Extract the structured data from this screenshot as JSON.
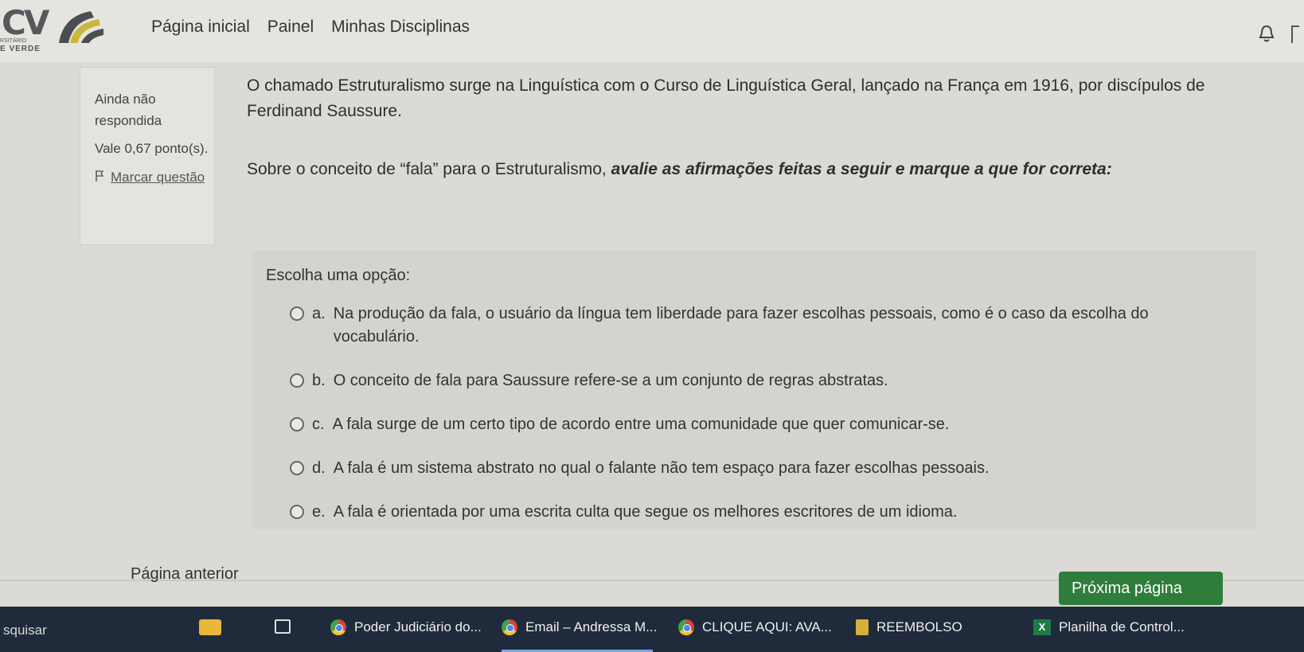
{
  "logo": {
    "text": "CV",
    "small_text": "RSITÁRIO",
    "bottom_text": "E VERDE"
  },
  "nav": {
    "links": [
      "Página inicial",
      "Painel",
      "Minhas Disciplinas"
    ],
    "bell_icon": "bell-icon"
  },
  "question_info": {
    "status": "Ainda não respondida",
    "grade": "Vale 0,67 ponto(s).",
    "flag_label": "Marcar questão",
    "flag_icon": "flag-icon"
  },
  "question": {
    "paragraph1": "O chamado Estruturalismo surge na Linguística com o Curso de Linguística Geral, lançado na França em 1916, por discípulos de Ferdinand Saussure.",
    "paragraph2_plain": "Sobre o conceito de “fala” para o Estruturalismo, ",
    "paragraph2_emph": "avalie as afirmações feitas a seguir e marque a que for correta:"
  },
  "answer": {
    "prompt": "Escolha uma opção:",
    "options": [
      {
        "letter": "a.",
        "text": "Na produção da fala, o usuário da língua tem liberdade para fazer escolhas pessoais, como é o caso da escolha do vocabulário."
      },
      {
        "letter": "b.",
        "text": "O conceito de fala para Saussure refere-se a um conjunto de regras abstratas."
      },
      {
        "letter": "c.",
        "text": "A fala surge de um certo tipo de acordo entre uma comunidade que quer comunicar-se."
      },
      {
        "letter": "d.",
        "text": "A fala é um sistema abstrato no qual o falante não tem espaço para fazer escolhas pessoais."
      },
      {
        "letter": "e.",
        "text": "A fala é orientada por uma escrita culta que segue os melhores escritores de um idioma."
      }
    ]
  },
  "page_nav": {
    "prev": "Página anterior",
    "next": "Próxima página"
  },
  "taskbar": {
    "search": "squisar",
    "items": [
      {
        "label": "Poder Judiciário do...",
        "icon": "chrome-icon"
      },
      {
        "label": "Email – Andressa M...",
        "icon": "chrome-icon"
      },
      {
        "label": "CLIQUE AQUI: AVA...",
        "icon": "chrome-icon"
      },
      {
        "label": "REEMBOLSO",
        "icon": "book-icon"
      },
      {
        "label": "Planilha de Control...",
        "icon": "excel-icon"
      }
    ]
  },
  "colors": {
    "next_button": "#2f7d3a",
    "taskbar": "#1f2a3a",
    "page_bg": "#dcdad6"
  }
}
